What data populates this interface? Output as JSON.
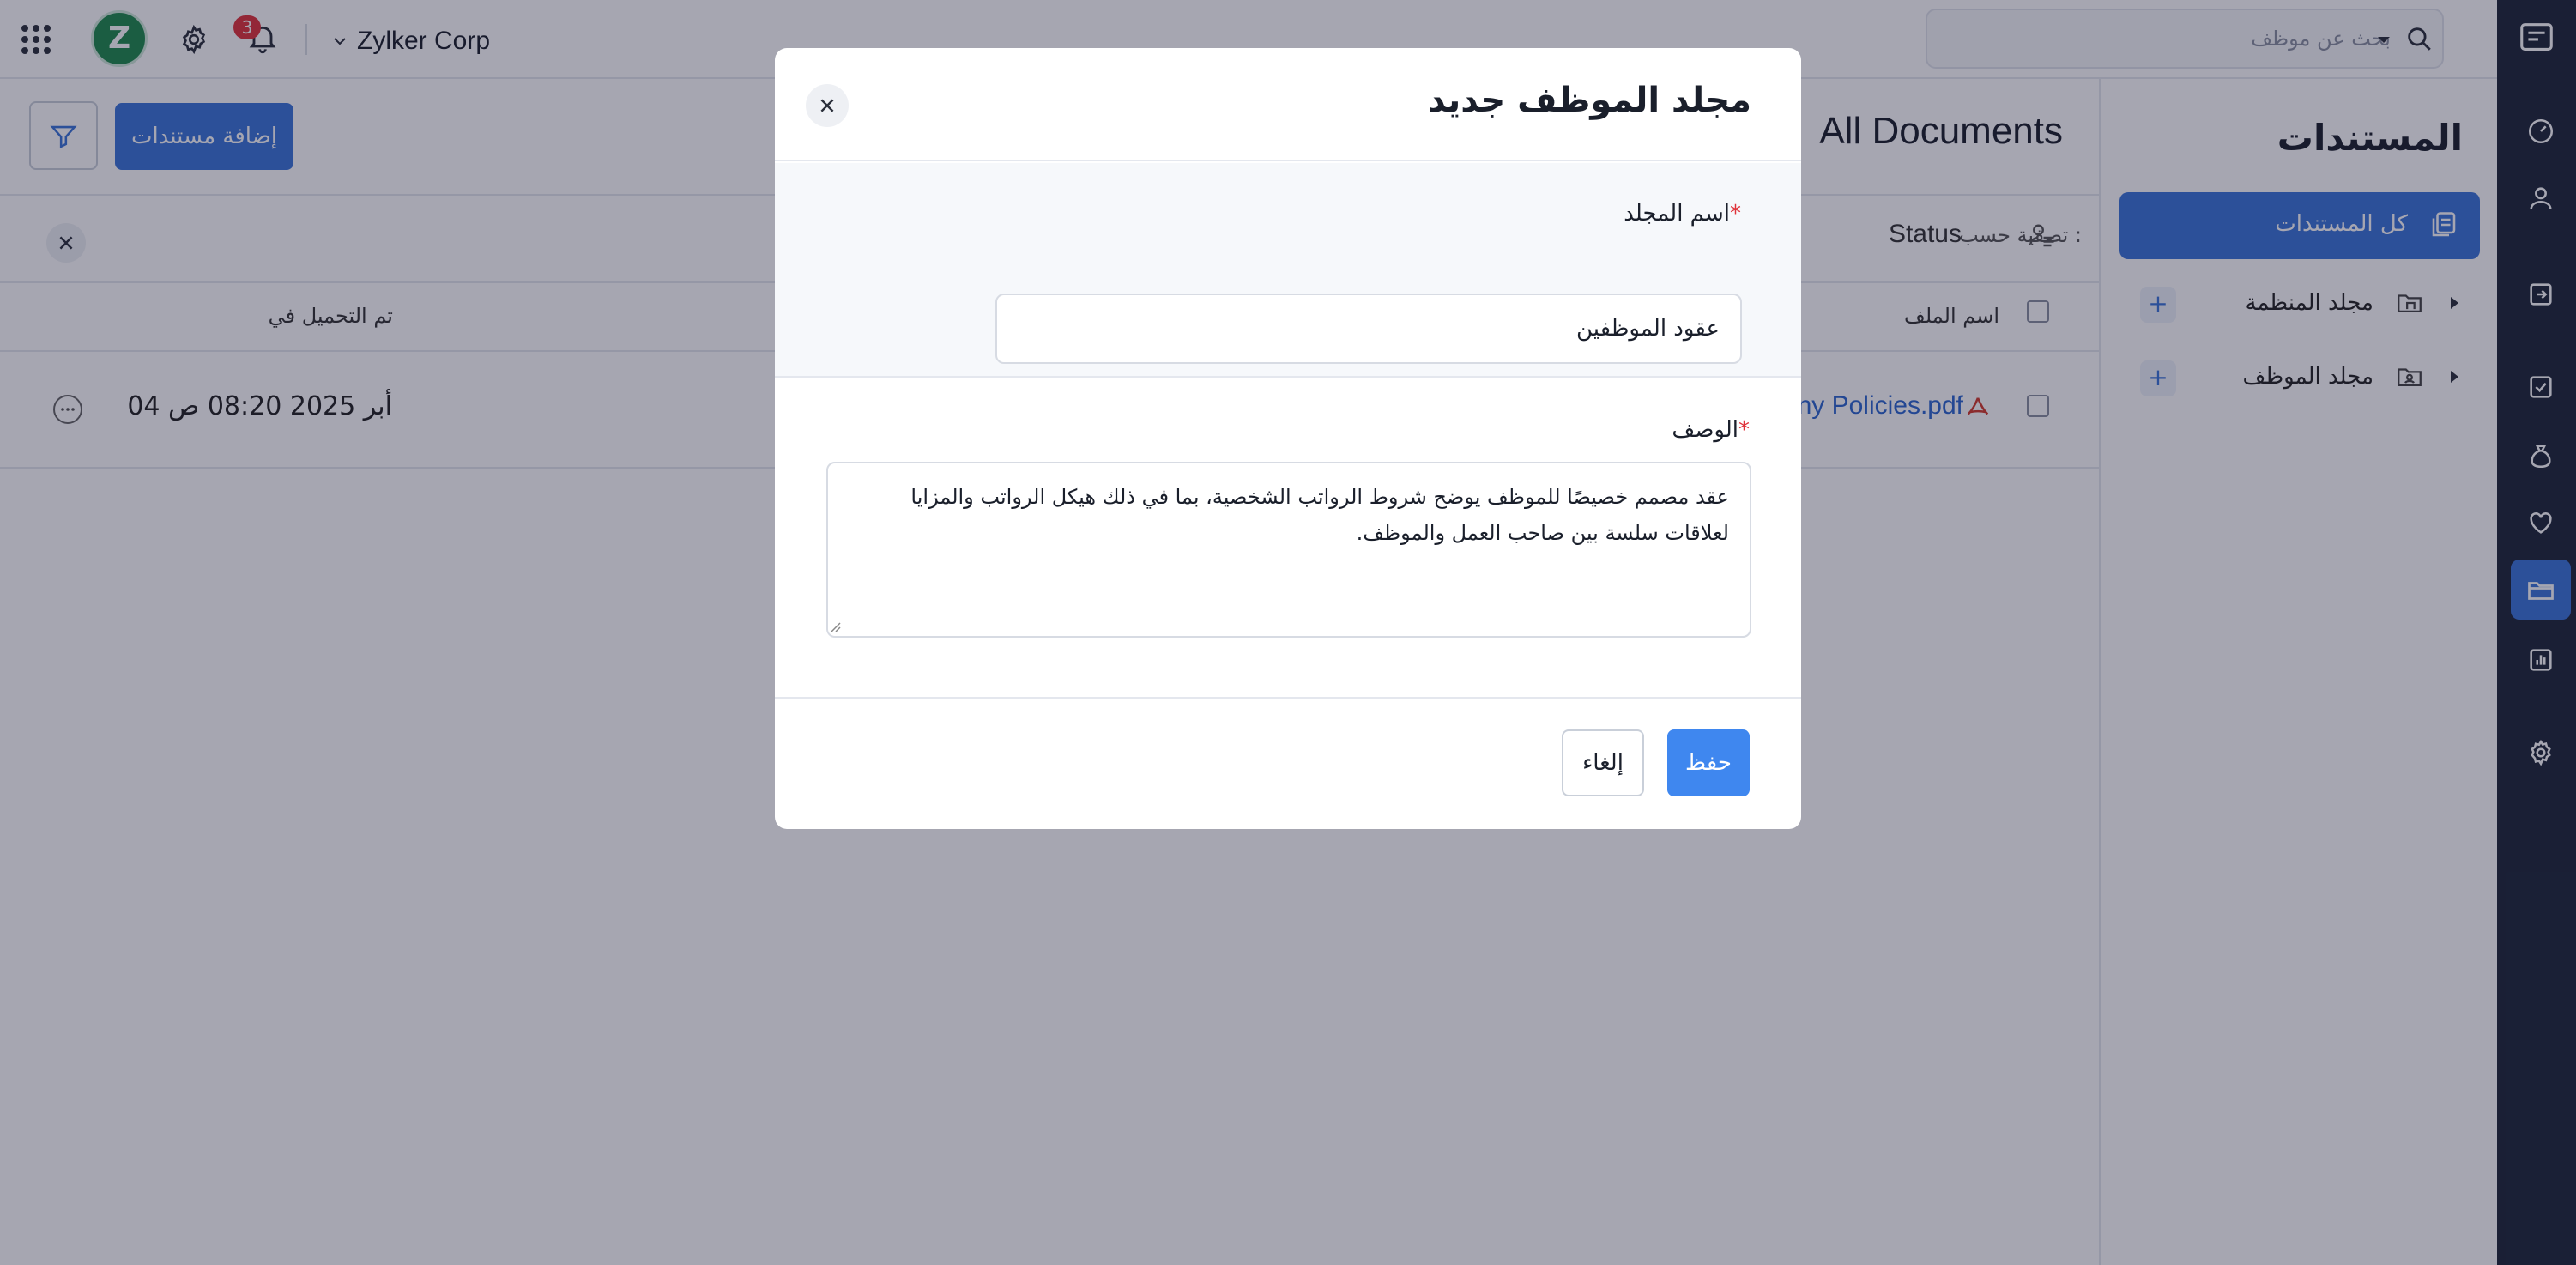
{
  "header": {
    "org_name": "Zylker Corp",
    "logo_letter": "Z",
    "notification_count": "3",
    "search": {
      "placeholder": "بحث عن موظف"
    }
  },
  "sidebar": {
    "title": "المستندات",
    "all_documents": "كل المستندات",
    "tree": [
      {
        "label": "مجلد المنظمة",
        "add": "+"
      },
      {
        "label": "مجلد الموظف",
        "add": "+"
      }
    ]
  },
  "main": {
    "title": "All Documents",
    "add_button": "إضافة مستندات",
    "filter_by": "تصفية حسب :",
    "filter_status": "Status",
    "columns": {
      "file_name": "اسم الملف",
      "uploaded_at": "تم التحميل في"
    },
    "rows": [
      {
        "file_name": "ny Policies.pdf",
        "uploaded_at": "04 أبر 2025 08:20 ص"
      }
    ]
  },
  "modal": {
    "title": "مجلد الموظف جديد",
    "folder_name_label": "اسم المجلد",
    "folder_name_value": "عقود الموظفين",
    "description_label": "الوصف",
    "required_mark": "*",
    "description_value": "عقد مصمم خصيصًا للموظف يوضح شروط الرواتب الشخصية، بما في ذلك هيكل الرواتب والمزايا لعلاقات سلسة بين صاحب العمل والموظف.",
    "save_label": "حفظ",
    "cancel_label": "إلغاء"
  },
  "colors": {
    "primary": "#3b74d9",
    "save_button": "#3f87ef",
    "rail_bg": "#1d2638",
    "logo_bg": "#1f8a4c",
    "badge": "#e0323a"
  },
  "icons": {
    "rail": [
      "app-logo-icon",
      "dashboard-icon",
      "person-icon",
      "login-icon",
      "checklist-icon",
      "money-bag-icon",
      "heart-icon",
      "folder-icon",
      "report-icon",
      "gear-icon"
    ]
  }
}
